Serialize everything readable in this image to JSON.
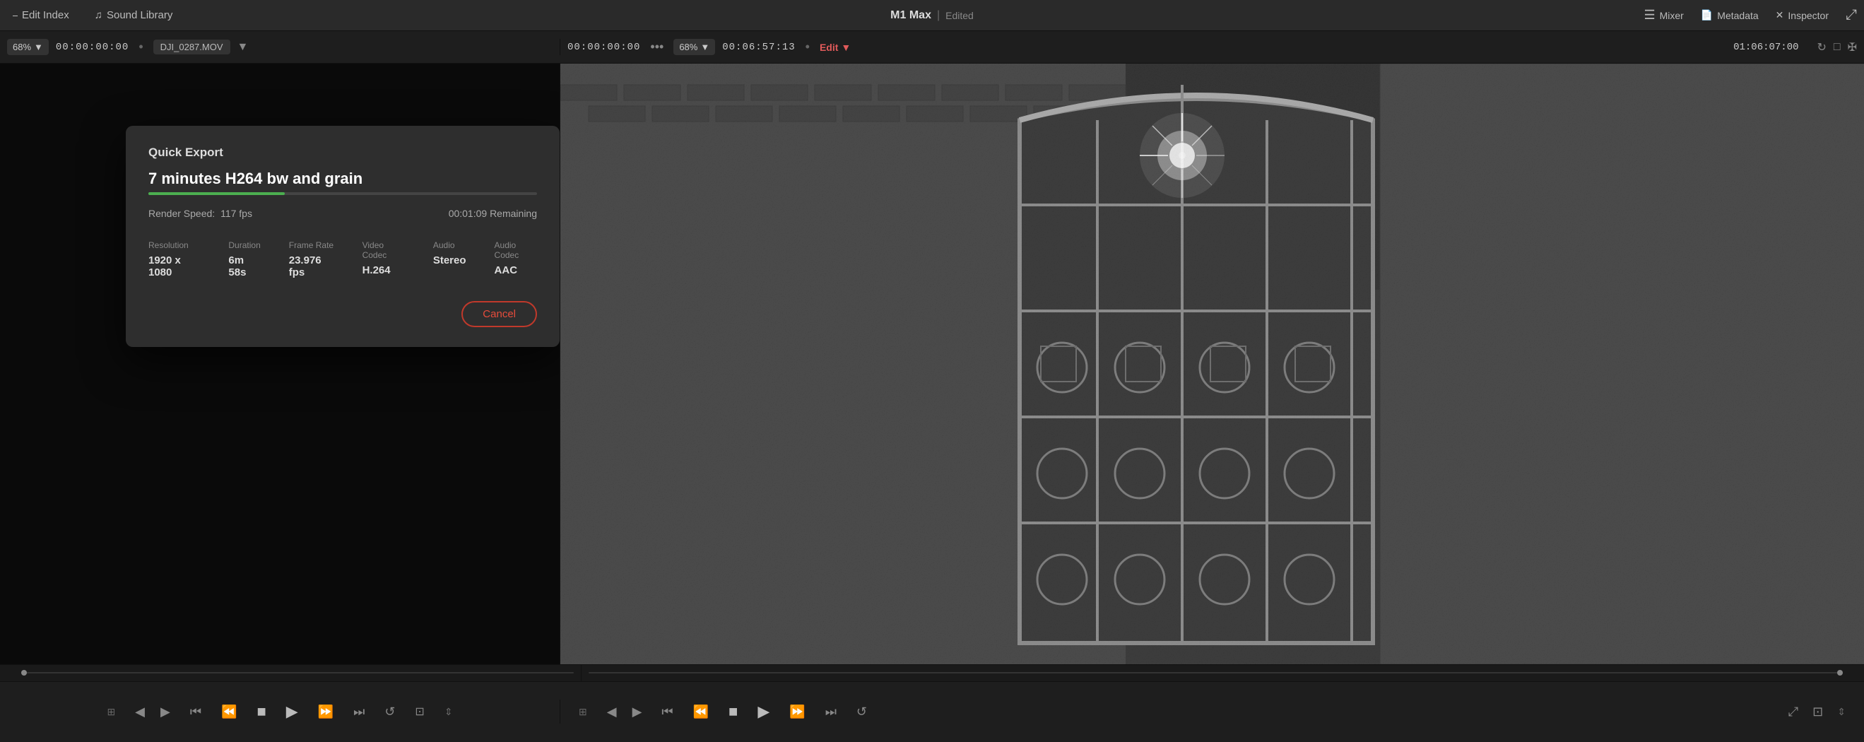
{
  "app": {
    "title": "M1 Max",
    "status": "Edited"
  },
  "topbar": {
    "edit_index_label": "Edit Index",
    "sound_library_label": "Sound Library",
    "mixer_label": "Mixer",
    "metadata_label": "Metadata",
    "inspector_label": "Inspector"
  },
  "viewer_left": {
    "zoom": "68%",
    "timecode": "00:00:00:00",
    "filename": "DJI_0287.MOV"
  },
  "viewer_right": {
    "timecode_current": "00:00:00:00",
    "zoom": "68%",
    "duration": "00:06:57:13",
    "edit_mode": "Edit",
    "right_timecode": "01:06:07:00"
  },
  "dialog": {
    "title": "Quick Export",
    "project_name": "7 minutes H264 bw and grain",
    "render_speed_label": "Render Speed:",
    "render_speed_value": "117 fps",
    "remaining_time": "00:01:09 Remaining",
    "progress_percent": 35,
    "specs": [
      {
        "label": "Resolution",
        "value": "1920 x 1080"
      },
      {
        "label": "Duration",
        "value": "6m 58s"
      },
      {
        "label": "Frame Rate",
        "value": "23.976 fps"
      },
      {
        "label": "Video Codec",
        "value": "H.264"
      },
      {
        "label": "Audio",
        "value": "Stereo"
      },
      {
        "label": "Audio Codec",
        "value": "AAC"
      }
    ],
    "cancel_label": "Cancel"
  },
  "transport": {
    "icons": [
      "⊞",
      "◁",
      "▷",
      "◀◀",
      "◀",
      "■",
      "▶",
      "▶▶",
      "↺",
      "⤢",
      "↕"
    ]
  }
}
